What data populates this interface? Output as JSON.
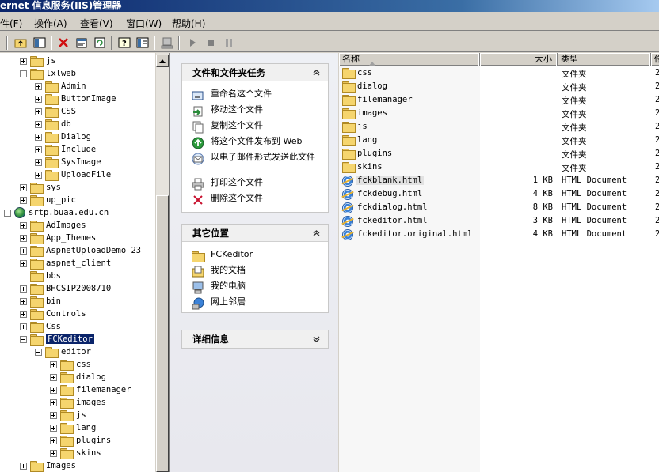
{
  "window": {
    "title": "ernet 信息服务(IIS)管理器"
  },
  "menu": [
    "件(F)",
    "操作(A)",
    "查看(V)",
    "窗口(W)",
    "帮助(H)"
  ],
  "tree": {
    "items": [
      {
        "label": "js",
        "level": 2,
        "expander": "plus"
      },
      {
        "label": "lxlweb",
        "level": 2,
        "expander": "minus"
      },
      {
        "label": "Admin",
        "level": 3,
        "expander": "plus"
      },
      {
        "label": "ButtonImage",
        "level": 3,
        "expander": "plus"
      },
      {
        "label": "CSS",
        "level": 3,
        "expander": "plus"
      },
      {
        "label": "db",
        "level": 3,
        "expander": "plus"
      },
      {
        "label": "Dialog",
        "level": 3,
        "expander": "plus"
      },
      {
        "label": "Include",
        "level": 3,
        "expander": "plus"
      },
      {
        "label": "SysImage",
        "level": 3,
        "expander": "plus"
      },
      {
        "label": "UploadFile",
        "level": 3,
        "expander": "plus"
      },
      {
        "label": "sys",
        "level": 2,
        "expander": "plus"
      },
      {
        "label": "up_pic",
        "level": 2,
        "expander": "plus"
      },
      {
        "label": "srtp.buaa.edu.cn",
        "level": 1,
        "expander": "minus",
        "icon": "globe"
      },
      {
        "label": "AdImages",
        "level": 2,
        "expander": "plus"
      },
      {
        "label": "App_Themes",
        "level": 2,
        "expander": "plus"
      },
      {
        "label": "AspnetUploadDemo_23",
        "level": 2,
        "expander": "plus"
      },
      {
        "label": "aspnet_client",
        "level": 2,
        "expander": "plus"
      },
      {
        "label": "bbs",
        "level": 2,
        "expander": "none"
      },
      {
        "label": "BHCSIP2008710",
        "level": 2,
        "expander": "plus"
      },
      {
        "label": "bin",
        "level": 2,
        "expander": "plus"
      },
      {
        "label": "Controls",
        "level": 2,
        "expander": "plus"
      },
      {
        "label": "Css",
        "level": 2,
        "expander": "plus"
      },
      {
        "label": "FCKeditor",
        "level": 2,
        "expander": "minus",
        "selected": true
      },
      {
        "label": "editor",
        "level": 3,
        "expander": "minus"
      },
      {
        "label": "css",
        "level": 4,
        "expander": "plus"
      },
      {
        "label": "dialog",
        "level": 4,
        "expander": "plus"
      },
      {
        "label": "filemanager",
        "level": 4,
        "expander": "plus"
      },
      {
        "label": "images",
        "level": 4,
        "expander": "plus"
      },
      {
        "label": "js",
        "level": 4,
        "expander": "plus"
      },
      {
        "label": "lang",
        "level": 4,
        "expander": "plus"
      },
      {
        "label": "plugins",
        "level": 4,
        "expander": "plus"
      },
      {
        "label": "skins",
        "level": 4,
        "expander": "plus"
      },
      {
        "label": "Images",
        "level": 2,
        "expander": "plus"
      }
    ]
  },
  "tasks_panel": {
    "title": "文件和文件夹任务",
    "items": [
      {
        "label": "重命名这个文件",
        "icon": "rename-icon"
      },
      {
        "label": "移动这个文件",
        "icon": "move-icon"
      },
      {
        "label": "复制这个文件",
        "icon": "copy-icon"
      },
      {
        "label": "将这个文件发布到 Web",
        "icon": "publish-web-icon"
      },
      {
        "label": "以电子邮件形式发送此文件",
        "icon": "email-icon"
      },
      {
        "label": "打印这个文件",
        "icon": "print-icon"
      },
      {
        "label": "删除这个文件",
        "icon": "delete-icon"
      }
    ]
  },
  "places_panel": {
    "title": "其它位置",
    "items": [
      {
        "label": "FCKeditor",
        "icon": "folder-icon"
      },
      {
        "label": "我的文档",
        "icon": "my-documents-icon"
      },
      {
        "label": "我的电脑",
        "icon": "my-computer-icon"
      },
      {
        "label": "网上邻居",
        "icon": "network-icon"
      }
    ]
  },
  "details_panel": {
    "title": "详细信息"
  },
  "list": {
    "columns": [
      "名称",
      "大小",
      "类型",
      "修"
    ],
    "rows": [
      {
        "name": "css",
        "size": "",
        "type": "文件夹",
        "extra": "2",
        "kind": "folder"
      },
      {
        "name": "dialog",
        "size": "",
        "type": "文件夹",
        "extra": "2",
        "kind": "folder"
      },
      {
        "name": "filemanager",
        "size": "",
        "type": "文件夹",
        "extra": "2",
        "kind": "folder"
      },
      {
        "name": "images",
        "size": "",
        "type": "文件夹",
        "extra": "2",
        "kind": "folder"
      },
      {
        "name": "js",
        "size": "",
        "type": "文件夹",
        "extra": "2",
        "kind": "folder"
      },
      {
        "name": "lang",
        "size": "",
        "type": "文件夹",
        "extra": "2",
        "kind": "folder"
      },
      {
        "name": "plugins",
        "size": "",
        "type": "文件夹",
        "extra": "2",
        "kind": "folder"
      },
      {
        "name": "skins",
        "size": "",
        "type": "文件夹",
        "extra": "2",
        "kind": "folder"
      },
      {
        "name": "fckblank.html",
        "size": "1 KB",
        "type": "HTML Document",
        "extra": "2",
        "kind": "html",
        "highlight": true
      },
      {
        "name": "fckdebug.html",
        "size": "4 KB",
        "type": "HTML Document",
        "extra": "2",
        "kind": "html"
      },
      {
        "name": "fckdialog.html",
        "size": "8 KB",
        "type": "HTML Document",
        "extra": "2",
        "kind": "html"
      },
      {
        "name": "fckeditor.html",
        "size": "3 KB",
        "type": "HTML Document",
        "extra": "2",
        "kind": "html"
      },
      {
        "name": "fckeditor.original.html",
        "size": "4 KB",
        "type": "HTML Document",
        "extra": "2",
        "kind": "html"
      }
    ]
  }
}
